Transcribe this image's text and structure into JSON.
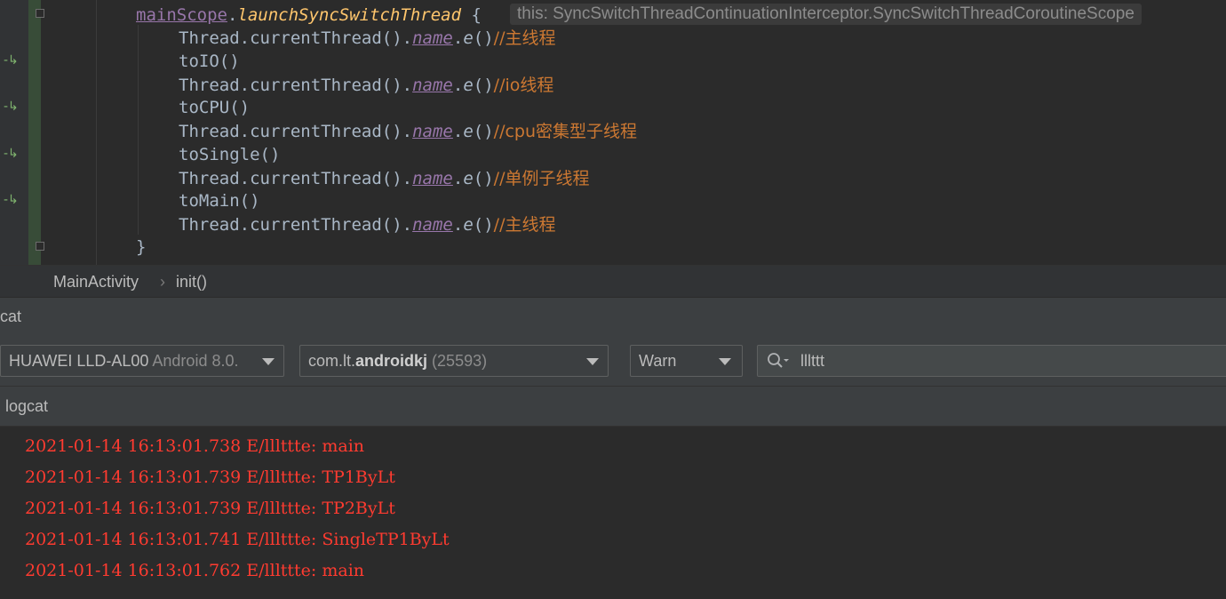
{
  "editor": {
    "lines": [
      {
        "receiver": "mainScope",
        "dot": ".",
        "fn": "launchSyncSwitchThread",
        "tail": " {"
      },
      {
        "pre": "Thread.currentThread().",
        "prop": "name",
        "dot": ".",
        "fn": "e",
        "call": "()",
        "comment": "//主线程"
      },
      {
        "plain": "toIO()"
      },
      {
        "pre": "Thread.currentThread().",
        "prop": "name",
        "dot": ".",
        "fn": "e",
        "call": "()",
        "comment": "//io线程"
      },
      {
        "plain": "toCPU()"
      },
      {
        "pre": "Thread.currentThread().",
        "prop": "name",
        "dot": ".",
        "fn": "e",
        "call": "()",
        "comment": "//cpu密集型子线程"
      },
      {
        "plain": "toSingle()"
      },
      {
        "pre": "Thread.currentThread().",
        "prop": "name",
        "dot": ".",
        "fn": "e",
        "call": "()",
        "comment": "//单例子线程"
      },
      {
        "plain": "toMain()"
      },
      {
        "pre": "Thread.currentThread().",
        "prop": "name",
        "dot": ".",
        "fn": "e",
        "call": "()",
        "comment": "//主线程"
      },
      {
        "plain": "}"
      }
    ],
    "inlay_hint": "this: SyncSwitchThreadContinuationInterceptor.SyncSwitchThreadCoroutineScope"
  },
  "breadcrumb": {
    "class_name": "MainActivity",
    "separator": "›",
    "method_name": "init()"
  },
  "toolwindow": {
    "title": "cat",
    "tab_label": "logcat"
  },
  "toolbar": {
    "device": {
      "name": "HUAWEI LLD-AL00",
      "os": "Android 8.0."
    },
    "process": {
      "prefix": "com.lt.",
      "package_bold": "androidkj",
      "pid": "(25593)"
    },
    "log_level": "Warn",
    "search_value": "lllttt"
  },
  "log": {
    "lines": [
      "2021-01-14 16:13:01.738 E/lllttte: main",
      "2021-01-14 16:13:01.739 E/lllttte: TP1ByLt",
      "2021-01-14 16:13:01.739 E/lllttte: TP2ByLt",
      "2021-01-14 16:13:01.741 E/lllttte: SingleTP1ByLt",
      "2021-01-14 16:13:01.762 E/lllttte: main"
    ],
    "color": "#ff3b30"
  },
  "colors": {
    "editor_bg": "#2b2b2b",
    "keyword_purple": "#9876aa",
    "function_yellow": "#ffc66d",
    "comment_orange": "#cc7832",
    "gutter_green": "#7fb36e"
  }
}
